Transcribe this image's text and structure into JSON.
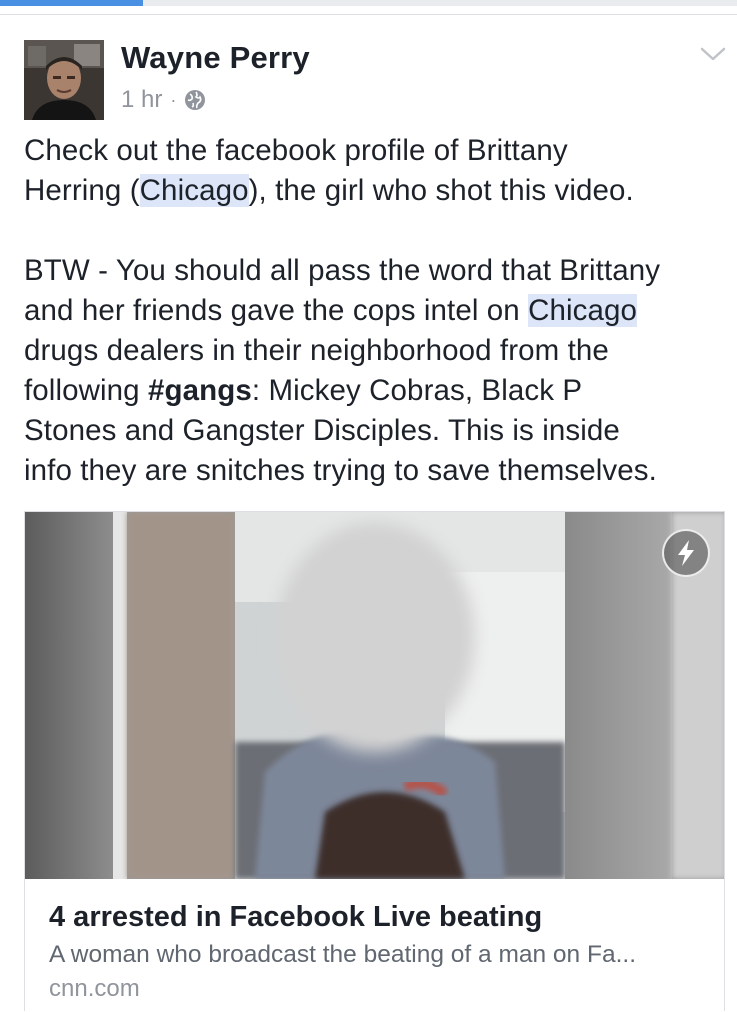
{
  "post": {
    "author": "Wayne Perry",
    "time": "1 hr",
    "separator": "·",
    "privacy_icon": "globe-icon",
    "menu_icon": "chevron-down-icon",
    "para1": {
      "line1": "Check out the facebook profile of Brittany",
      "line2_pre": "Herring (",
      "line2_hl": "Chicago",
      "line2_post": "), the girl who shot this video."
    },
    "para2": {
      "line1": "BTW - You should all pass the word that Brittany",
      "line2_pre": "and her friends gave the cops intel on ",
      "line2_hl": "Chicago",
      "line3": "drugs dealers in their neighborhood from the",
      "line4_pre": "following ",
      "line4_bold": "#gangs",
      "line4_post": ": Mickey Cobras, Black P",
      "line5": "Stones and Gangster Disciples. This is inside",
      "line6": "info they are snitches trying to save themselves."
    }
  },
  "link_card": {
    "title": "4 arrested in Facebook Live beating",
    "description": "A woman who broadcast the beating of a man on Fa...",
    "domain": "cnn.com",
    "badge_icon": "instant-article-bolt-icon"
  },
  "colors": {
    "highlight": "#dce6f8",
    "text": "#1d2129",
    "secondary": "#90949c",
    "progress": "#4a90e2"
  }
}
